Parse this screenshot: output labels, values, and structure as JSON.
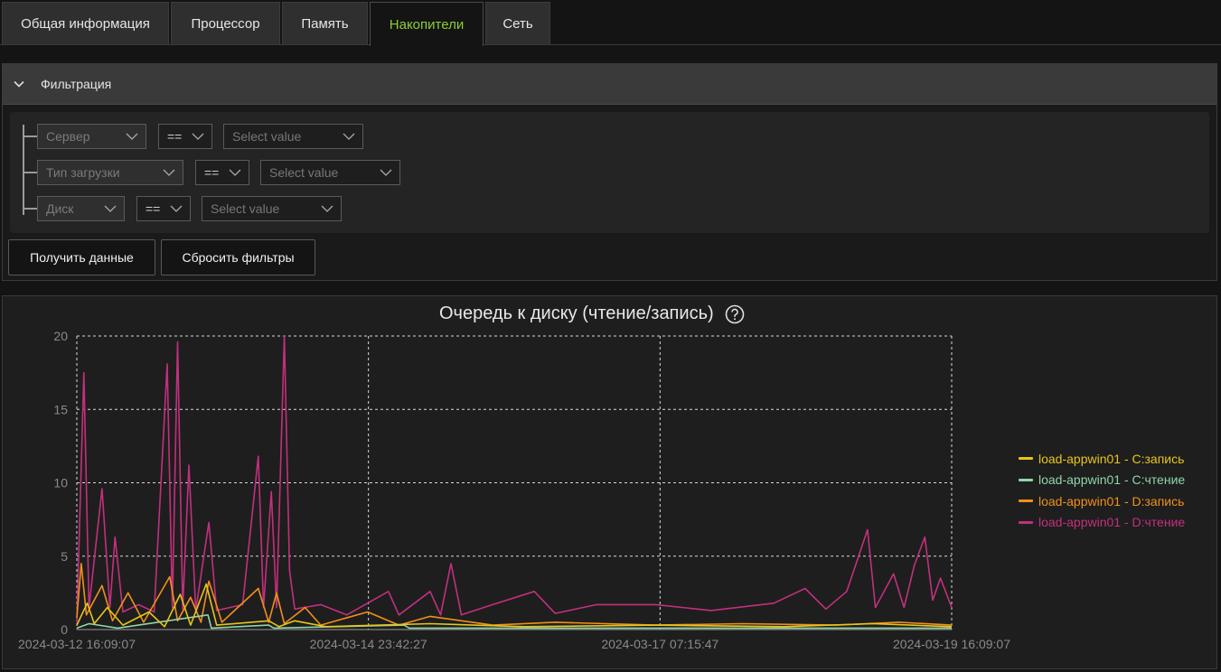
{
  "tabs": [
    {
      "label": "Общая информация",
      "active": false
    },
    {
      "label": "Процессор",
      "active": false
    },
    {
      "label": "Память",
      "active": false
    },
    {
      "label": "Накопители",
      "active": true
    },
    {
      "label": "Сеть",
      "active": false
    }
  ],
  "filter": {
    "header": "Фильтрация",
    "rules": [
      {
        "field": "Сервер",
        "operator": "==",
        "value_placeholder": "Select value"
      },
      {
        "field": "Тип загрузки",
        "operator": "==",
        "value_placeholder": "Select value"
      },
      {
        "field": "Диск",
        "operator": "==",
        "value_placeholder": "Select value"
      }
    ],
    "get_data_label": "Получить данные",
    "reset_label": "Сбросить фильтры"
  },
  "chart_data": {
    "type": "line",
    "title": "Очередь к диску (чтение/запись)",
    "xlabel": "",
    "ylabel": "",
    "ylim": [
      0,
      20
    ],
    "yticks": [
      0,
      5,
      10,
      15,
      20
    ],
    "xticks": [
      "2024-03-12 16:09:07",
      "2024-03-14 23:42:27",
      "2024-03-17 07:15:47",
      "2024-03-19 16:09:07"
    ],
    "x_range": [
      "2024-03-12 16:09:07",
      "2024-03-19 16:09:07"
    ],
    "grid": true,
    "legend_position": "right",
    "series": [
      {
        "name": "load-appwin01 - C:запись",
        "color": "#e8c51c",
        "points": [
          [
            "2024-03-12 16:09:07",
            0.3
          ],
          [
            "2024-03-12 18:09:07",
            1.8
          ],
          [
            "2024-03-12 19:30:00",
            0.4
          ],
          [
            "2024-03-12 22:00:00",
            1.5
          ],
          [
            "2024-03-13 01:00:00",
            0.3
          ],
          [
            "2024-03-13 06:00:00",
            1.2
          ],
          [
            "2024-03-13 09:00:00",
            0.2
          ],
          [
            "2024-03-13 12:00:00",
            2.4
          ],
          [
            "2024-03-13 14:00:00",
            0.3
          ],
          [
            "2024-03-13 17:00:00",
            3.1
          ],
          [
            "2024-03-13 19:00:00",
            0.3
          ],
          [
            "2024-03-14 05:00:00",
            0.6
          ],
          [
            "2024-03-14 07:00:00",
            0.2
          ],
          [
            "2024-03-14 10:00:00",
            0.6
          ],
          [
            "2024-03-14 16:00:00",
            0.2
          ],
          [
            "2024-03-15 12:00:00",
            0.4
          ],
          [
            "2024-03-16 06:00:00",
            0.2
          ],
          [
            "2024-03-17 07:15:47",
            0.3
          ],
          [
            "2024-03-18 08:00:00",
            0.2
          ],
          [
            "2024-03-19 01:00:00",
            0.4
          ],
          [
            "2024-03-19 16:09:07",
            0.2
          ]
        ]
      },
      {
        "name": "load-appwin01 - C:чтение",
        "color": "#8fd6a8",
        "points": [
          [
            "2024-03-12 16:09:07",
            0.1
          ],
          [
            "2024-03-12 18:30:00",
            0.4
          ],
          [
            "2024-03-13 00:00:00",
            0.1
          ],
          [
            "2024-03-13 17:20:00",
            1.0
          ],
          [
            "2024-03-13 18:00:00",
            0.1
          ],
          [
            "2024-03-14 05:00:00",
            0.3
          ],
          [
            "2024-03-14 06:00:00",
            0.1
          ],
          [
            "2024-03-15 07:00:00",
            0.3
          ],
          [
            "2024-03-15 08:00:00",
            0.1
          ],
          [
            "2024-03-17 07:15:47",
            0.1
          ],
          [
            "2024-03-19 16:09:07",
            0.1
          ]
        ]
      },
      {
        "name": "load-appwin01 - D:запись",
        "color": "#f0901c",
        "points": [
          [
            "2024-03-12 16:09:07",
            0.8
          ],
          [
            "2024-03-12 17:00:00",
            4.5
          ],
          [
            "2024-03-12 18:00:00",
            1.0
          ],
          [
            "2024-03-12 21:00:00",
            3.0
          ],
          [
            "2024-03-12 23:00:00",
            0.6
          ],
          [
            "2024-03-13 02:00:00",
            2.5
          ],
          [
            "2024-03-13 05:00:00",
            0.5
          ],
          [
            "2024-03-13 10:00:00",
            3.6
          ],
          [
            "2024-03-13 11:30:00",
            0.6
          ],
          [
            "2024-03-13 14:00:00",
            2.2
          ],
          [
            "2024-03-13 16:00:00",
            0.5
          ],
          [
            "2024-03-13 17:30:00",
            3.3
          ],
          [
            "2024-03-13 20:00:00",
            0.5
          ],
          [
            "2024-03-14 03:00:00",
            2.8
          ],
          [
            "2024-03-14 05:00:00",
            0.5
          ],
          [
            "2024-03-14 06:30:00",
            2.5
          ],
          [
            "2024-03-14 08:00:00",
            0.4
          ],
          [
            "2024-03-14 12:00:00",
            1.5
          ],
          [
            "2024-03-14 15:00:00",
            0.3
          ],
          [
            "2024-03-15 00:00:00",
            1.2
          ],
          [
            "2024-03-15 06:00:00",
            0.3
          ],
          [
            "2024-03-15 12:00:00",
            0.9
          ],
          [
            "2024-03-16 00:00:00",
            0.3
          ],
          [
            "2024-03-16 12:00:00",
            0.5
          ],
          [
            "2024-03-17 07:15:47",
            0.3
          ],
          [
            "2024-03-18 00:00:00",
            0.4
          ],
          [
            "2024-03-18 18:00:00",
            0.3
          ],
          [
            "2024-03-19 06:00:00",
            0.5
          ],
          [
            "2024-03-19 16:09:07",
            0.3
          ]
        ]
      },
      {
        "name": "load-appwin01 - D:чтение",
        "color": "#c2307e",
        "points": [
          [
            "2024-03-12 16:09:07",
            0.5
          ],
          [
            "2024-03-12 17:30:00",
            17.5
          ],
          [
            "2024-03-12 18:30:00",
            1.5
          ],
          [
            "2024-03-12 21:00:00",
            9.6
          ],
          [
            "2024-03-12 22:30:00",
            1.5
          ],
          [
            "2024-03-12 23:30:00",
            6.3
          ],
          [
            "2024-03-13 01:00:00",
            1.2
          ],
          [
            "2024-03-13 04:00:00",
            1.7
          ],
          [
            "2024-03-13 07:00:00",
            1.2
          ],
          [
            "2024-03-13 09:30:00",
            18.1
          ],
          [
            "2024-03-13 10:30:00",
            1.5
          ],
          [
            "2024-03-13 11:30:00",
            19.6
          ],
          [
            "2024-03-13 12:30:00",
            1.4
          ],
          [
            "2024-03-13 13:40:00",
            11.2
          ],
          [
            "2024-03-13 15:00:00",
            1.3
          ],
          [
            "2024-03-13 17:30:00",
            7.3
          ],
          [
            "2024-03-13 19:00:00",
            1.3
          ],
          [
            "2024-03-14 00:00:00",
            1.7
          ],
          [
            "2024-03-14 03:00:00",
            11.8
          ],
          [
            "2024-03-14 04:00:00",
            1.5
          ],
          [
            "2024-03-14 05:30:00",
            9.4
          ],
          [
            "2024-03-14 06:30:00",
            1.5
          ],
          [
            "2024-03-14 08:00:00",
            20.0
          ],
          [
            "2024-03-14 09:00:00",
            4.0
          ],
          [
            "2024-03-14 10:00:00",
            1.4
          ],
          [
            "2024-03-14 15:00:00",
            1.7
          ],
          [
            "2024-03-14 20:00:00",
            1.0
          ],
          [
            "2024-03-15 04:00:00",
            2.6
          ],
          [
            "2024-03-15 06:00:00",
            1.0
          ],
          [
            "2024-03-15 12:00:00",
            2.6
          ],
          [
            "2024-03-15 14:00:00",
            1.0
          ],
          [
            "2024-03-15 16:00:00",
            4.5
          ],
          [
            "2024-03-15 18:00:00",
            1.0
          ],
          [
            "2024-03-16 00:00:00",
            1.7
          ],
          [
            "2024-03-16 08:00:00",
            2.6
          ],
          [
            "2024-03-16 12:00:00",
            1.1
          ],
          [
            "2024-03-16 20:00:00",
            1.7
          ],
          [
            "2024-03-17 07:15:47",
            1.7
          ],
          [
            "2024-03-17 18:00:00",
            1.3
          ],
          [
            "2024-03-18 06:00:00",
            1.8
          ],
          [
            "2024-03-18 12:00:00",
            2.8
          ],
          [
            "2024-03-18 16:00:00",
            1.4
          ],
          [
            "2024-03-18 20:00:00",
            2.6
          ],
          [
            "2024-03-19 00:00:00",
            6.8
          ],
          [
            "2024-03-19 01:30:00",
            1.5
          ],
          [
            "2024-03-19 05:00:00",
            3.8
          ],
          [
            "2024-03-19 07:00:00",
            1.5
          ],
          [
            "2024-03-19 09:00:00",
            4.4
          ],
          [
            "2024-03-19 11:00:00",
            6.3
          ],
          [
            "2024-03-19 12:30:00",
            2.0
          ],
          [
            "2024-03-19 14:00:00",
            3.5
          ],
          [
            "2024-03-19 16:09:07",
            1.5
          ]
        ]
      }
    ]
  }
}
